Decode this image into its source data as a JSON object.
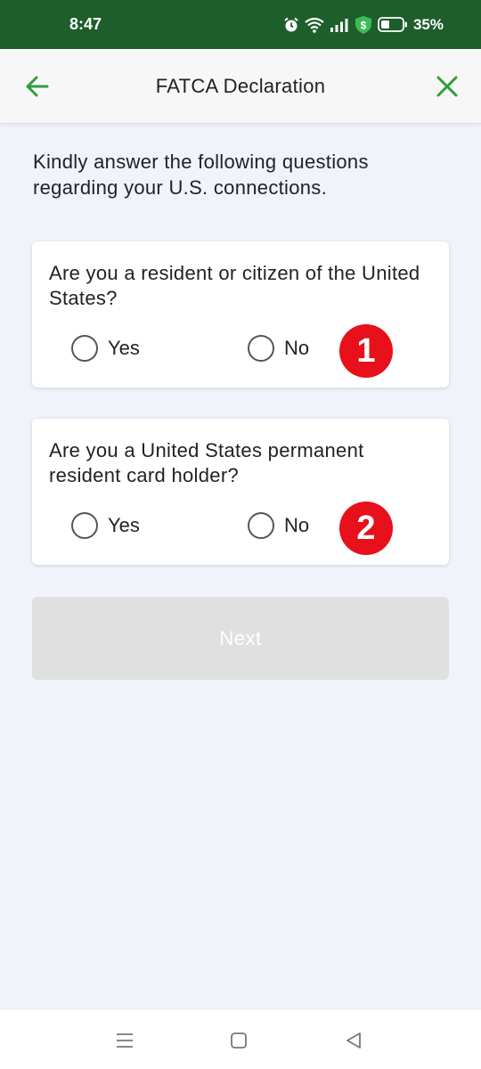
{
  "status_bar": {
    "time": "8:47",
    "battery": "35%",
    "icons": [
      "alarm-icon",
      "wifi-icon",
      "signal-icon",
      "shield-icon",
      "battery-icon"
    ]
  },
  "header": {
    "title": "FATCA Declaration",
    "back_icon": "arrow-left-icon",
    "close_icon": "close-icon"
  },
  "intro": "Kindly answer the following questions regarding your U.S. connections.",
  "questions": [
    {
      "text": "Are you a resident or citizen of the United States?",
      "yes_label": "Yes",
      "no_label": "No",
      "selected": null,
      "badge": "1"
    },
    {
      "text": "Are you a United States permanent resident card holder?",
      "yes_label": "Yes",
      "no_label": "No",
      "selected": null,
      "badge": "2"
    }
  ],
  "next_button": {
    "label": "Next",
    "enabled": false
  },
  "colors": {
    "status_bar": "#1d5e2b",
    "accent": "#2e9e3e",
    "badge": "#e8101b",
    "background": "#f0f3fa",
    "disabled_button": "#e0e0e0"
  },
  "nav_bar": {
    "icons": [
      "menu-icon",
      "home-icon",
      "back-icon"
    ]
  }
}
